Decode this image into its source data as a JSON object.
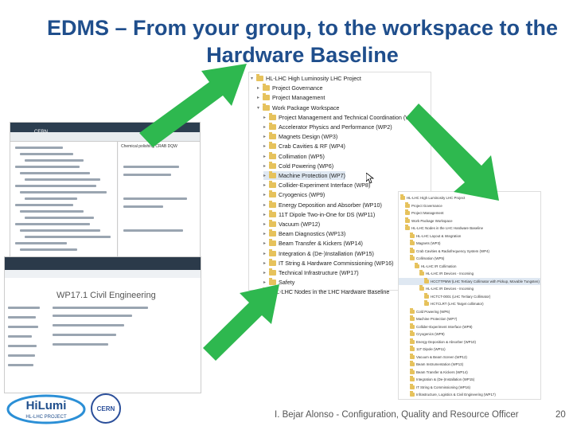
{
  "title": "EDMS – From your group, to the workspace to the Hardware Baseline",
  "tree": {
    "root": "HL-LHC High Luminosity LHC Project",
    "items": [
      "Project Governance",
      "Project Management",
      "Work Package Workspace",
      "Project Management and Technical Coordination (WP1)",
      "Accelerator Physics and Performance (WP2)",
      "Magnets Design (WP3)",
      "Crab Cavities & RF (WP4)",
      "Collimation (WP5)",
      "Cold Powering (WP6)",
      "Machine Protection (WP7)",
      "Collider-Experiment Interface (WP8)",
      "Cryogenics (WP9)",
      "Energy Deposition and Absorber (WP10)",
      "11T Dipole Two-in-One for DS (WP11)",
      "Vacuum (WP12)",
      "Beam Diagnostics (WP13)",
      "Beam Transfer & Kickers (WP14)",
      "Integration & (De-)Installation (WP15)",
      "IT String & Hardware Commissioning (WP16)",
      "Technical Infrastructure (WP17)",
      "Safety",
      "HL-LHC Nodes in the LHC Hardware Baseline"
    ]
  },
  "left_shot": {
    "header": "CERN",
    "doc_label": "Chemical polishing CRAB DQW",
    "page_title": "WP17.1 Civil Engineering"
  },
  "right_shot": {
    "items": [
      "HL-LHC High Luminosity LHC Project",
      "Project Governance",
      "Project Management",
      "Work Package Workspace",
      "HL-LHC Nodes in the LHC Hardware Baseline",
      "HL-LHC Layout & Integration",
      "Magnets (WP3)",
      "Crab Cavities & Radiofrequency System (WP4)",
      "Collimation (WP5)",
      "HL-LHC IR Collimation",
      "HL-LHC IR Devices - Incoming",
      "HCCTTPMW (LHC Tertiary Collimator with Pickup, Movable Tungsten)",
      "HL-LHC IR Devices - Incoming",
      "HCTCT-0001 (LHC Tertiary Collimator)",
      "HCTCLRT (LHC Target collimator)",
      "Cold Powering (WP6)",
      "Machine Protection (WP7)",
      "Collider-Experiment Interface (WP8)",
      "Cryogenics (WP9)",
      "Energy Deposition & Absorber (WP10)",
      "11T Dipole (WP11)",
      "Vacuum & Beam Screen (WP12)",
      "Beam Instrumentation (WP13)",
      "Beam Transfer & Kickers (WP14)",
      "Integration & (De-)Installation (WP15)",
      "IT String & Commissioning (WP16)",
      "Infrastructure, Logistics & Civil Engineering (WP17)"
    ]
  },
  "footer": {
    "presenter": "I. Bejar Alonso - Configuration, Quality and Resource Officer",
    "page": "20",
    "logo_text": "HiLumi",
    "logo_sub": "HL-LHC PROJECT",
    "cern": "CERN"
  },
  "colors": {
    "title": "#1f4e8c",
    "arrow": "#2eb84f",
    "selection": "#dfe8f2"
  }
}
